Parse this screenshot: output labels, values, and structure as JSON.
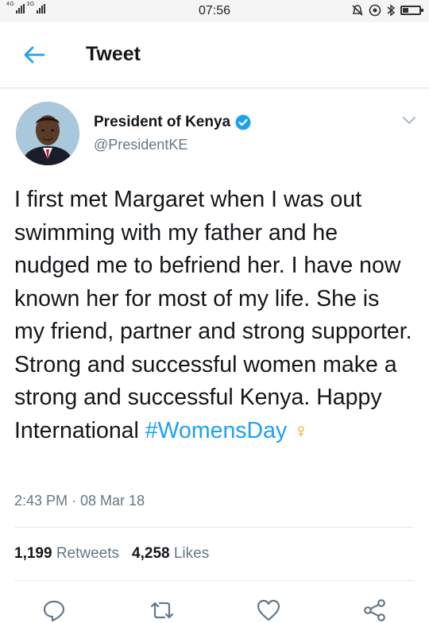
{
  "status_bar": {
    "network_left": "4G",
    "network_right": "3G",
    "time": "07:56"
  },
  "header": {
    "title": "Tweet"
  },
  "tweet": {
    "author_name": "President of Kenya",
    "author_handle": "@PresidentKE",
    "text_before_hashtag": "I first met Margaret when I was out swimming with my father and he nudged me to befriend her. I have now known her for most of my life. She is my friend, partner and strong supporter.  Strong and successful women make a strong and successful Kenya. Happy International ",
    "hashtag": "#WomensDay",
    "emoji": "♀",
    "timestamp": "2:43 PM · 08 Mar 18",
    "retweets_count": "1,199",
    "retweets_label": "Retweets",
    "likes_count": "4,258",
    "likes_label": "Likes"
  },
  "colors": {
    "accent": "#1da1f2",
    "secondary_text": "#657786",
    "primary_text": "#14171a",
    "divider": "#e1e8ed"
  },
  "icons": {
    "back": "arrow-left-icon",
    "verified": "verified-badge-icon",
    "caret": "chevron-down-icon",
    "reply": "reply-icon",
    "retweet": "retweet-icon",
    "like": "heart-icon",
    "share": "share-icon"
  }
}
